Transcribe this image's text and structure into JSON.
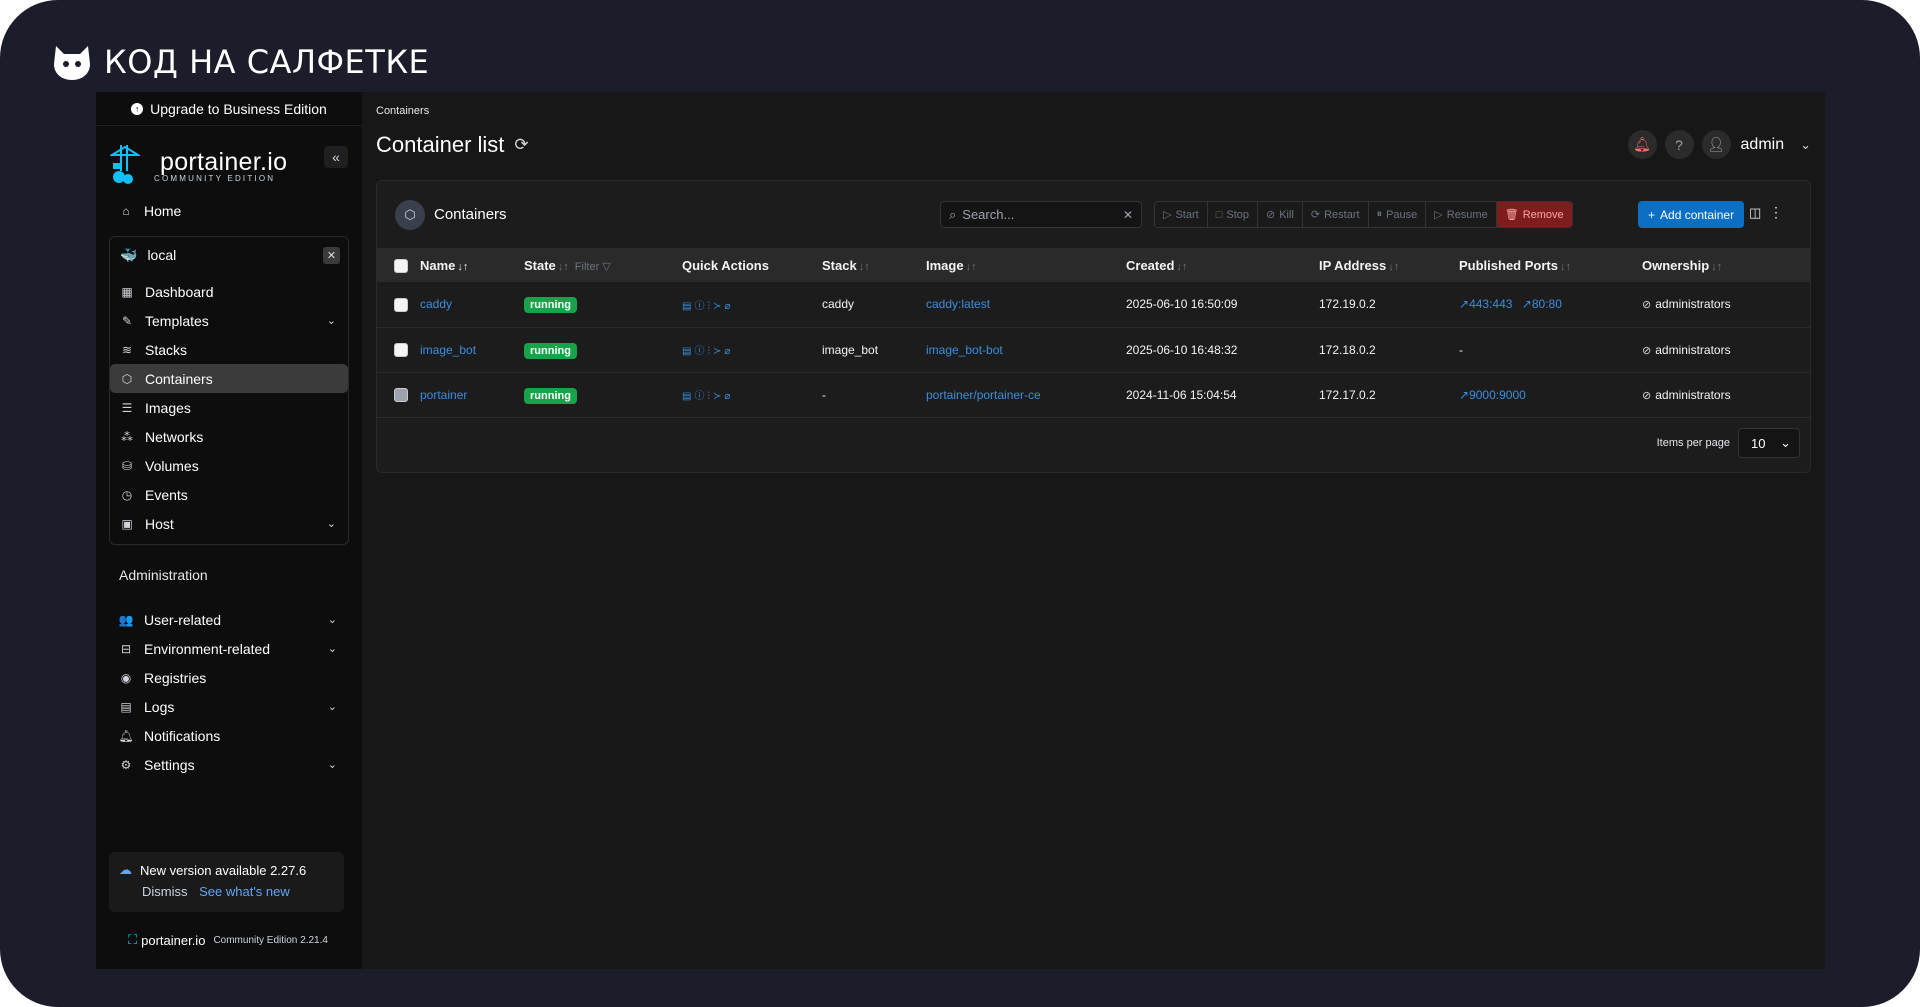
{
  "overlay_brand": "КОД НА САЛФЕТКЕ",
  "sidebar": {
    "upgrade_label": "Upgrade to Business Edition",
    "logo_main": "portainer.io",
    "logo_sub": "COMMUNITY EDITION",
    "home_label": "Home",
    "environment": {
      "name": "local",
      "items": [
        {
          "label": "Dashboard",
          "icon": "dashboard-icon"
        },
        {
          "label": "Templates",
          "icon": "edit-icon",
          "expandable": true
        },
        {
          "label": "Stacks",
          "icon": "layers-icon"
        },
        {
          "label": "Containers",
          "icon": "cube-icon",
          "active": true
        },
        {
          "label": "Images",
          "icon": "list-icon"
        },
        {
          "label": "Networks",
          "icon": "network-icon"
        },
        {
          "label": "Volumes",
          "icon": "database-icon"
        },
        {
          "label": "Events",
          "icon": "clock-icon"
        },
        {
          "label": "Host",
          "icon": "host-icon",
          "expandable": true
        }
      ]
    },
    "administration_title": "Administration",
    "admin_items": [
      {
        "label": "User-related",
        "icon": "users-icon",
        "expandable": true
      },
      {
        "label": "Environment-related",
        "icon": "drive-icon",
        "expandable": true
      },
      {
        "label": "Registries",
        "icon": "radio-icon"
      },
      {
        "label": "Logs",
        "icon": "file-icon",
        "expandable": true
      },
      {
        "label": "Notifications",
        "icon": "bell-icon"
      },
      {
        "label": "Settings",
        "icon": "gear-icon",
        "expandable": true
      }
    ],
    "update": {
      "message": "New version available 2.27.6",
      "dismiss": "Dismiss",
      "see_new": "See what's new"
    },
    "footer": {
      "brand": "portainer.io",
      "edition": "Community Edition 2.21.4"
    }
  },
  "header": {
    "breadcrumb": "Containers",
    "title": "Container list",
    "user": "admin"
  },
  "card": {
    "title": "Containers",
    "search_placeholder": "Search...",
    "actions": [
      "Start",
      "Stop",
      "Kill",
      "Restart",
      "Pause",
      "Resume",
      "Remove"
    ],
    "add_label": "Add container",
    "columns": [
      "Name",
      "State",
      "Quick Actions",
      "Stack",
      "Image",
      "Created",
      "IP Address",
      "Published Ports",
      "Ownership"
    ],
    "filter_label": "Filter",
    "rows": [
      {
        "name": "caddy",
        "state": "running",
        "stack": "caddy",
        "image": "caddy:latest",
        "created": "2025-06-10 16:50:09",
        "ip": "172.19.0.2",
        "ports": [
          "443:443",
          "80:80"
        ],
        "ownership": "administrators"
      },
      {
        "name": "image_bot",
        "state": "running",
        "stack": "image_bot",
        "image": "image_bot-bot",
        "created": "2025-06-10 16:48:32",
        "ip": "172.18.0.2",
        "ports": [],
        "ports_empty": "-",
        "ownership": "administrators"
      },
      {
        "name": "portainer",
        "state": "running",
        "stack": "-",
        "image": "portainer/portainer-ce",
        "created": "2024-11-06 15:04:54",
        "ip": "172.17.0.2",
        "ports": [
          "9000:9000"
        ],
        "ownership": "administrators"
      }
    ],
    "items_per_page_label": "Items per page",
    "items_per_page": "10"
  },
  "colors": {
    "accent": "#0b6fc4",
    "running": "#16a34a",
    "link": "#3b8ede"
  }
}
